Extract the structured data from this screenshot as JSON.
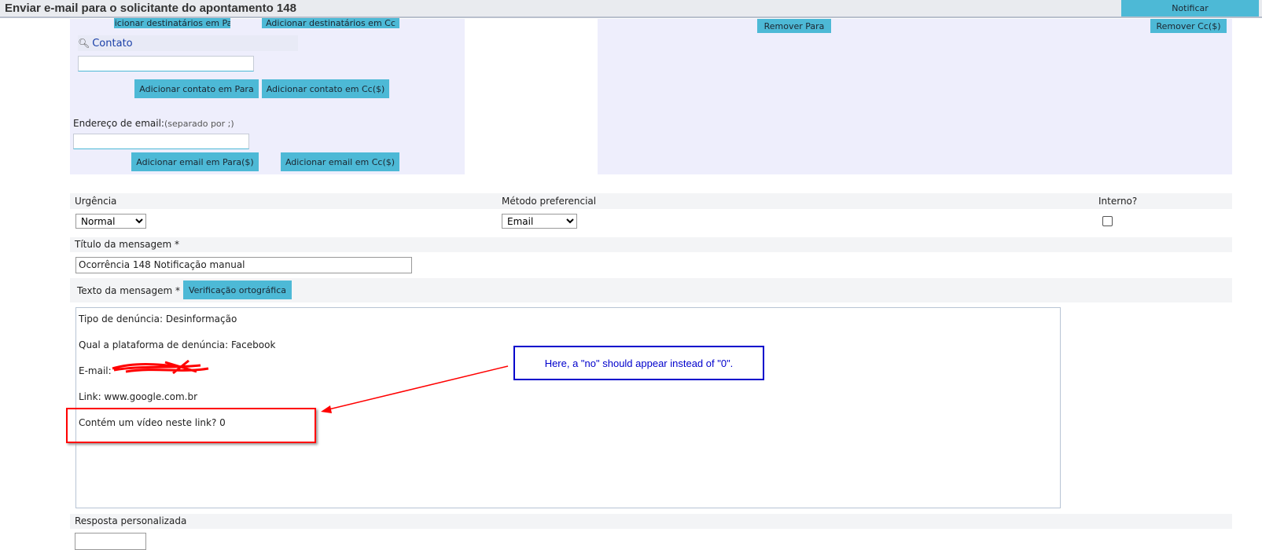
{
  "window": {
    "title": "Enviar e-mail para o solicitante do apontamento 148",
    "notify_label": "Notificar"
  },
  "recipients": {
    "add_recipients_to": "Adicionar destinatários em Para",
    "add_recipients_cc": "Adicionar destinatários em Cc",
    "contact_label": "Contato",
    "contact_value": "",
    "add_contact_to": "Adicionar contato em Para",
    "add_contact_cc": "Adicionar contato em Cc($)",
    "email_label": "Endereço de email:",
    "email_hint": "(separado por ;)",
    "email_value": "",
    "add_email_to": "Adicionar email em Para($)",
    "add_email_cc": "Adicionar email em Cc($)",
    "remove_to": "Remover Para",
    "remove_cc": "Remover Cc($)"
  },
  "form": {
    "urgency_label": "Urgência",
    "urgency_value": "Normal",
    "method_label": "Método preferencial",
    "method_value": "Email",
    "internal_label": "Interno?",
    "internal_checked": false,
    "subject_label": "Título da mensagem *",
    "subject_value": "Ocorrência 148 Notificação manual",
    "body_label": "Texto da mensagem *",
    "spellcheck_label": "Verificação ortográfica",
    "body_lines": [
      "Tipo de denúncia: Desinformação",
      "Qual a plataforma de denúncia: Facebook",
      "E-mail: ",
      "Link: www.google.com.br",
      "Contém um vídeo neste link? 0"
    ],
    "custom_reply_label": "Resposta personalizada"
  },
  "annotation": {
    "text": "Here, a \"no\" should appear instead of \"0\".",
    "box_color": "#0000cc",
    "highlight_color": "#ff0000"
  }
}
